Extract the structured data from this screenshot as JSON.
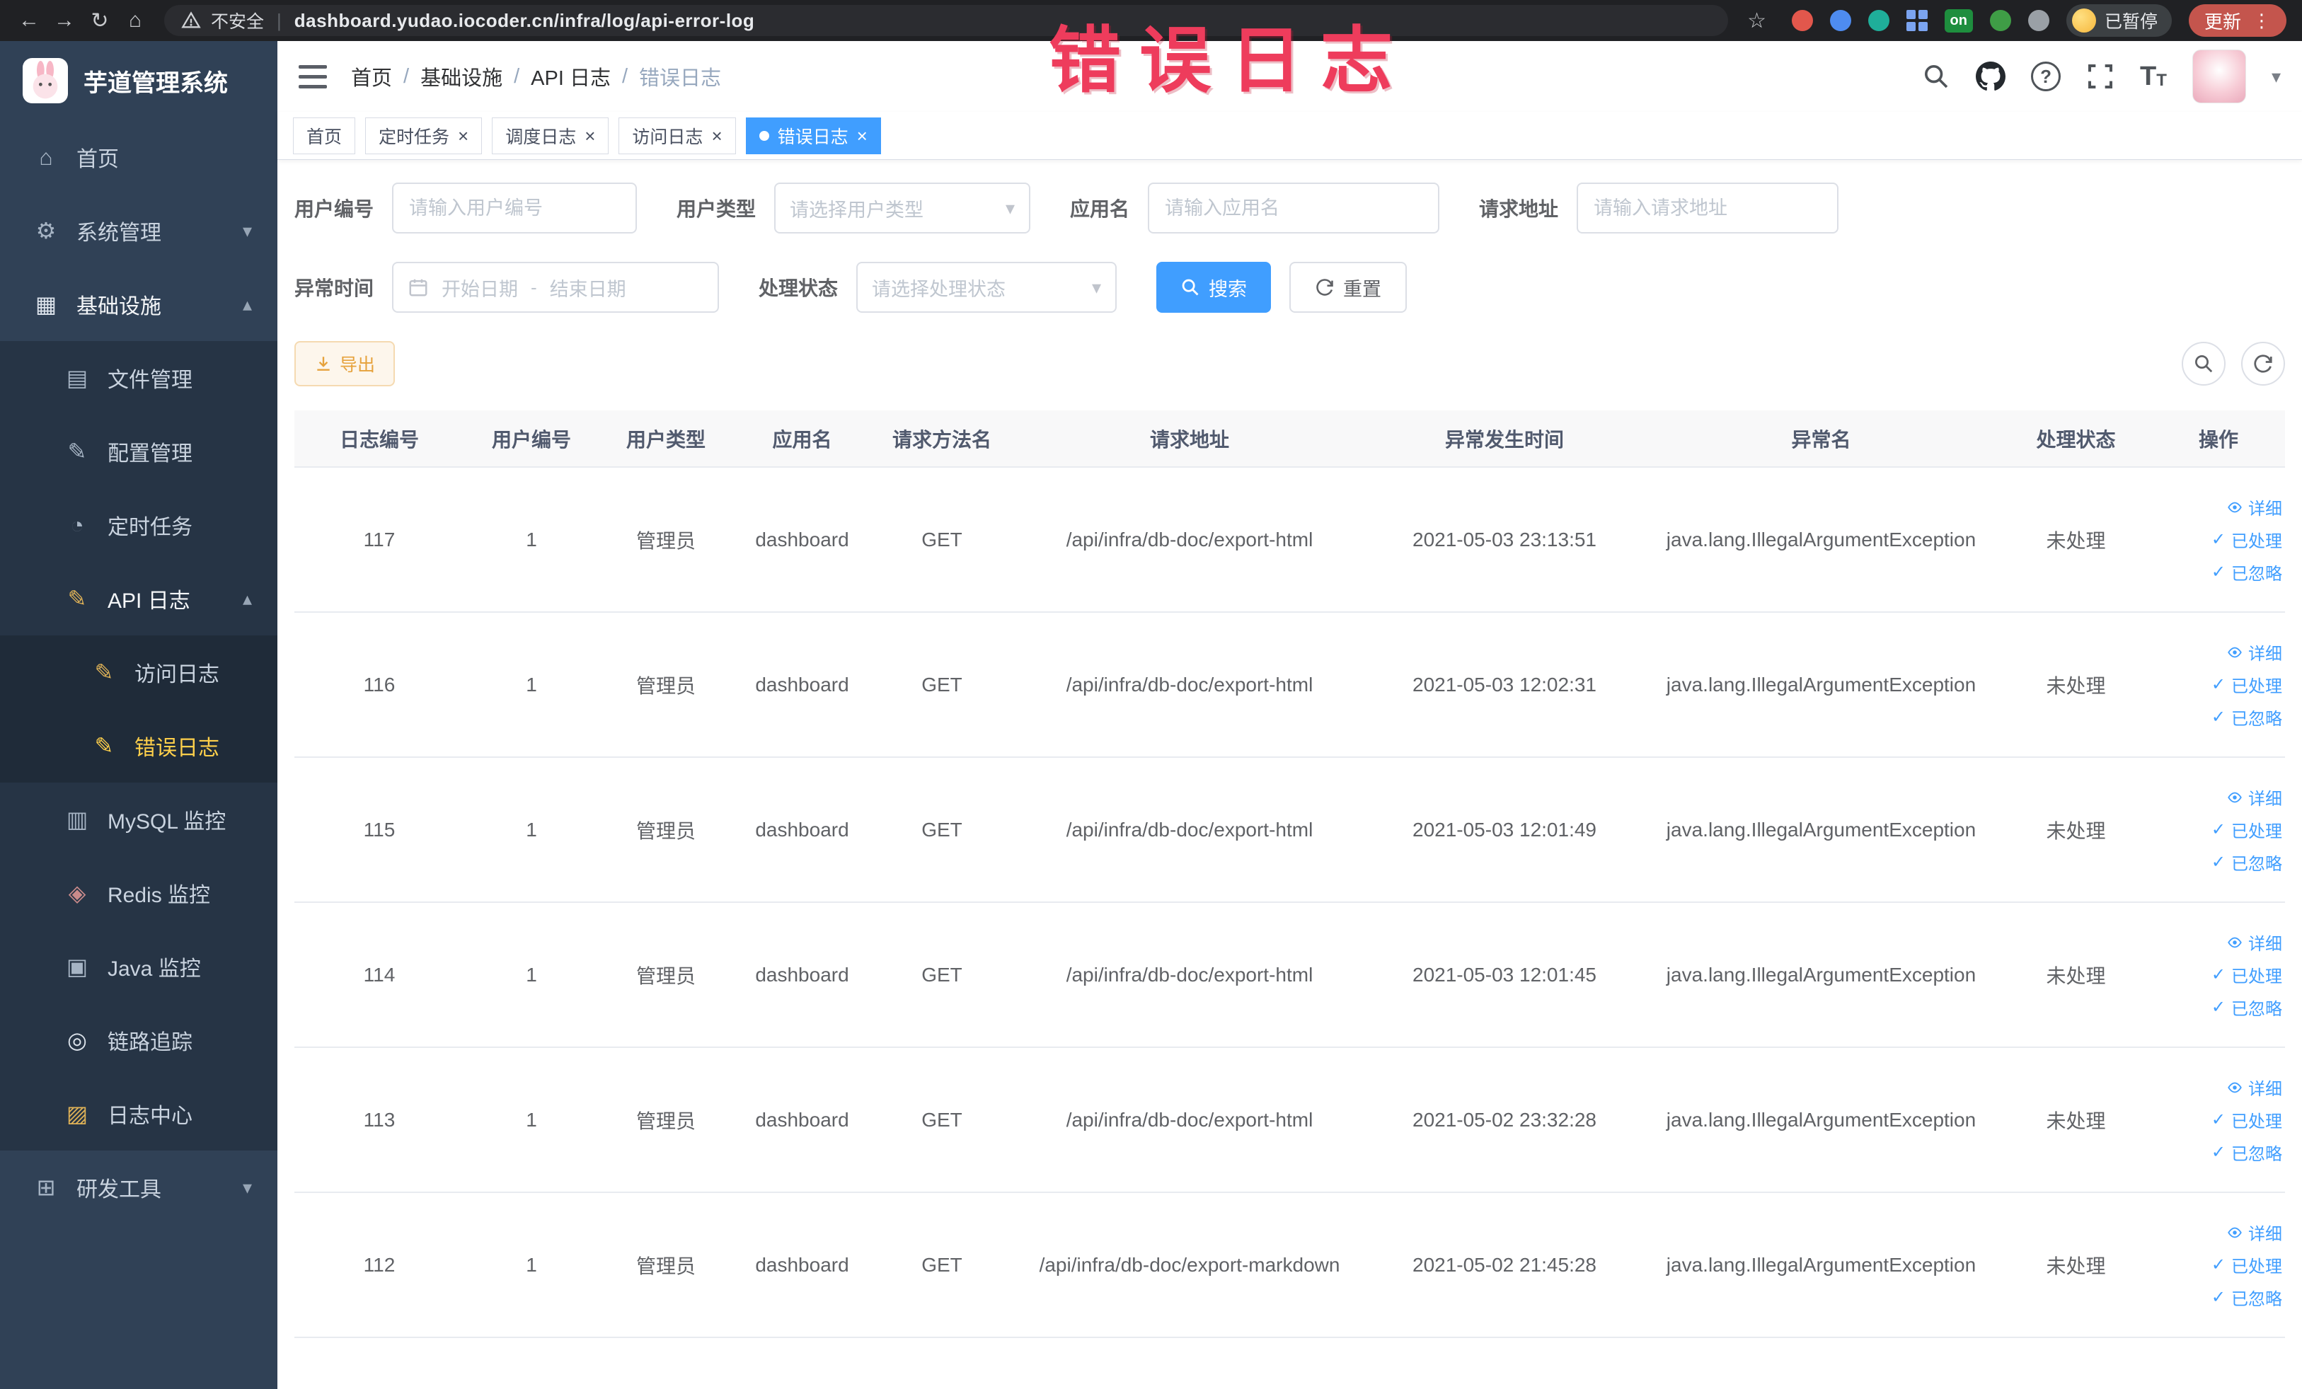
{
  "annotation": {
    "text": "错误日志"
  },
  "browser": {
    "security_label": "不安全",
    "url": "dashboard.yudao.iocoder.cn/infra/log/api-error-log",
    "on_badge": "on",
    "paused_label": "已暂停",
    "update_label": "更新"
  },
  "icons": {
    "back": "←",
    "forward": "→",
    "reload": "↻",
    "home": "⌂",
    "star": "☆",
    "kebab": "⋮",
    "pipe": "|",
    "caret_down": "▾",
    "question": "?",
    "font_big": "T",
    "font_small": "T",
    "check": "✓",
    "slash": "/"
  },
  "sidebar": {
    "title": "芋道管理系统",
    "items": [
      {
        "label": "首页",
        "icon": "home-icon",
        "glyph": "⌂"
      },
      {
        "label": "系统管理",
        "icon": "gear-icon",
        "glyph": "⚙",
        "arrow": "▾"
      },
      {
        "label": "基础设施",
        "icon": "infra-icon",
        "glyph": "▦",
        "arrow": "▴"
      },
      {
        "label": "文件管理",
        "icon": "folder-icon",
        "glyph": "▤"
      },
      {
        "label": "配置管理",
        "icon": "config-icon",
        "glyph": "✎"
      },
      {
        "label": "定时任务",
        "icon": "timer-icon",
        "glyph": "◔"
      },
      {
        "label": "API 日志",
        "icon": "api-log-icon",
        "glyph": "✎",
        "arrow": "▴"
      },
      {
        "label": "访问日志",
        "icon": "access-log-icon",
        "glyph": "✎"
      },
      {
        "label": "错误日志",
        "icon": "error-log-icon",
        "glyph": "✎"
      },
      {
        "label": "MySQL 监控",
        "icon": "mysql-icon",
        "glyph": "▥"
      },
      {
        "label": "Redis 监控",
        "icon": "redis-icon",
        "glyph": "◈"
      },
      {
        "label": "Java 监控",
        "icon": "java-icon",
        "glyph": "▣"
      },
      {
        "label": "链路追踪",
        "icon": "trace-icon",
        "glyph": "◎"
      },
      {
        "label": "日志中心",
        "icon": "log-center-icon",
        "glyph": "▨"
      },
      {
        "label": "研发工具",
        "icon": "devtools-icon",
        "glyph": "⊞",
        "arrow": "▾"
      }
    ]
  },
  "navbar": {
    "breadcrumb": [
      "首页",
      "基础设施",
      "API 日志",
      "错误日志"
    ],
    "separator": "/"
  },
  "tabs": [
    {
      "label": "首页"
    },
    {
      "label": "定时任务",
      "close": "×"
    },
    {
      "label": "调度日志",
      "close": "×"
    },
    {
      "label": "访问日志",
      "close": "×"
    },
    {
      "label": "错误日志",
      "close": "×",
      "active": true
    }
  ],
  "filters": {
    "user_id": {
      "label": "用户编号",
      "placeholder": "请输入用户编号"
    },
    "user_type": {
      "label": "用户类型",
      "placeholder": "请选择用户类型"
    },
    "app_name": {
      "label": "应用名",
      "placeholder": "请输入应用名"
    },
    "request_url": {
      "label": "请求地址",
      "placeholder": "请输入请求地址"
    },
    "exception_time": {
      "label": "异常时间",
      "start_placeholder": "开始日期",
      "separator": "-",
      "end_placeholder": "结束日期"
    },
    "process_status": {
      "label": "处理状态",
      "placeholder": "请选择处理状态"
    },
    "search_label": "搜索",
    "reset_label": "重置"
  },
  "toolbar": {
    "export_label": "导出"
  },
  "table": {
    "headers": [
      "日志编号",
      "用户编号",
      "用户类型",
      "应用名",
      "请求方法名",
      "请求地址",
      "异常发生时间",
      "异常名",
      "处理状态",
      "操作"
    ],
    "actions": {
      "detail": "详细",
      "processed": "已处理",
      "ignored": "已忽略"
    },
    "rows": [
      {
        "id": "117",
        "user_id": "1",
        "user_type": "管理员",
        "app": "dashboard",
        "method": "GET",
        "url": "/api/infra/db-doc/export-html",
        "time": "2021-05-03 23:13:51",
        "exception": "java.lang.IllegalArgumentException",
        "status": "未处理"
      },
      {
        "id": "116",
        "user_id": "1",
        "user_type": "管理员",
        "app": "dashboard",
        "method": "GET",
        "url": "/api/infra/db-doc/export-html",
        "time": "2021-05-03 12:02:31",
        "exception": "java.lang.IllegalArgumentException",
        "status": "未处理"
      },
      {
        "id": "115",
        "user_id": "1",
        "user_type": "管理员",
        "app": "dashboard",
        "method": "GET",
        "url": "/api/infra/db-doc/export-html",
        "time": "2021-05-03 12:01:49",
        "exception": "java.lang.IllegalArgumentException",
        "status": "未处理"
      },
      {
        "id": "114",
        "user_id": "1",
        "user_type": "管理员",
        "app": "dashboard",
        "method": "GET",
        "url": "/api/infra/db-doc/export-html",
        "time": "2021-05-03 12:01:45",
        "exception": "java.lang.IllegalArgumentException",
        "status": "未处理"
      },
      {
        "id": "113",
        "user_id": "1",
        "user_type": "管理员",
        "app": "dashboard",
        "method": "GET",
        "url": "/api/infra/db-doc/export-html",
        "time": "2021-05-02 23:32:28",
        "exception": "java.lang.IllegalArgumentException",
        "status": "未处理"
      },
      {
        "id": "112",
        "user_id": "1",
        "user_type": "管理员",
        "app": "dashboard",
        "method": "GET",
        "url": "/api/infra/db-doc/export-markdown",
        "time": "2021-05-02 21:45:28",
        "exception": "java.lang.IllegalArgumentException",
        "status": "未处理"
      }
    ]
  }
}
